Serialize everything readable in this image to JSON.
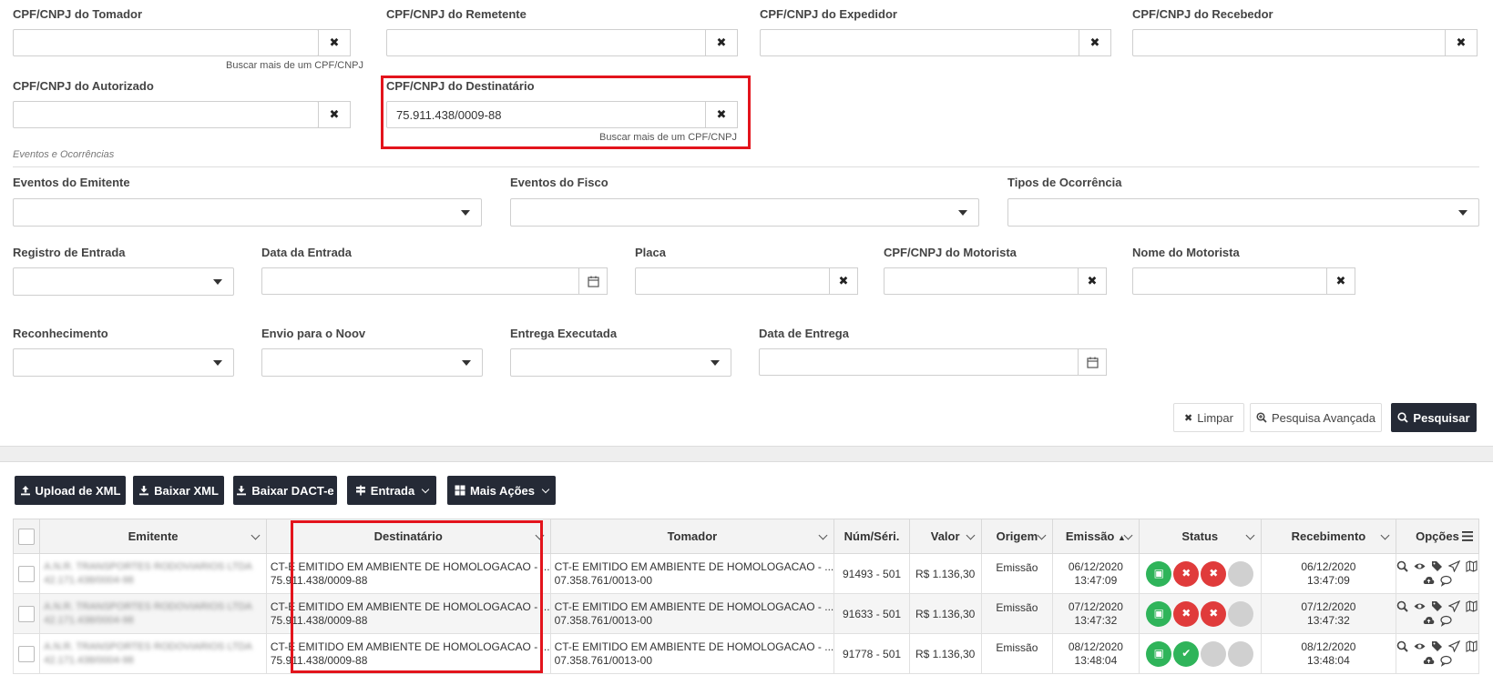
{
  "filters": {
    "tomador": {
      "label": "CPF/CNPJ do Tomador",
      "value": "",
      "hint": "Buscar mais de um CPF/CNPJ"
    },
    "remetente": {
      "label": "CPF/CNPJ do Remetente",
      "value": ""
    },
    "expedidor": {
      "label": "CPF/CNPJ do Expedidor",
      "value": ""
    },
    "recebedor": {
      "label": "CPF/CNPJ do Recebedor",
      "value": ""
    },
    "autorizado": {
      "label": "CPF/CNPJ do Autorizado",
      "value": ""
    },
    "destinatario": {
      "label": "CPF/CNPJ do Destinatário",
      "value": "75.911.438/0009-88",
      "hint": "Buscar mais de um CPF/CNPJ"
    },
    "clear_glyph": "✖",
    "section_title": "Eventos e Ocorrências",
    "eventos_emitente": {
      "label": "Eventos do Emitente"
    },
    "eventos_fisco": {
      "label": "Eventos do Fisco"
    },
    "tipos_ocorrencia": {
      "label": "Tipos de Ocorrência"
    },
    "registro_entrada": {
      "label": "Registro de Entrada"
    },
    "data_entrada": {
      "label": "Data da Entrada",
      "value": ""
    },
    "placa": {
      "label": "Placa",
      "value": ""
    },
    "cpf_motorista": {
      "label": "CPF/CNPJ do Motorista",
      "value": ""
    },
    "nome_motorista": {
      "label": "Nome do Motorista",
      "value": ""
    },
    "reconhecimento": {
      "label": "Reconhecimento"
    },
    "envio_noov": {
      "label": "Envio para o Noov"
    },
    "entrega_executada": {
      "label": "Entrega Executada"
    },
    "data_entrega": {
      "label": "Data de Entrega",
      "value": ""
    }
  },
  "actions": {
    "limpar": "Limpar",
    "pesquisa_avancada": "Pesquisa Avançada",
    "pesquisar": "Pesquisar"
  },
  "toolbar": {
    "upload_xml": "Upload de XML",
    "baixar_xml": "Baixar XML",
    "baixar_dacte": "Baixar DACT-e",
    "entrada": "Entrada",
    "mais_acoes": "Mais Ações"
  },
  "table": {
    "headers": {
      "emitente": "Emitente",
      "destinatario": "Destinatário",
      "tomador": "Tomador",
      "num_serie": "Núm/Séri.",
      "valor": "Valor",
      "origem": "Origem",
      "emissao": "Emissão",
      "status": "Status",
      "recebimento": "Recebimento",
      "opcoes": "Opções"
    },
    "rows": [
      {
        "emitente_name": "A.N.R. TRANSPORTES RODOVIARIOS LTDA",
        "emitente_doc": "42.171.438/0004-98",
        "dest_name": "CT-E EMITIDO EM AMBIENTE DE HOMOLOGACAO - ...",
        "dest_doc": "75.911.438/0009-88",
        "tom_name": "CT-E EMITIDO EM AMBIENTE DE HOMOLOGACAO - ...",
        "tom_doc": "07.358.761/0013-00",
        "num": "91493 - 501",
        "valor": "R$ 1.136,30",
        "origem": "Emissão",
        "emissao_date": "06/12/2020",
        "emissao_time": "13:47:09",
        "rec_date": "06/12/2020",
        "rec_time": "13:47:09"
      },
      {
        "emitente_name": "A.N.R. TRANSPORTES RODOVIARIOS LTDA",
        "emitente_doc": "42.171.438/0004-98",
        "dest_name": "CT-E EMITIDO EM AMBIENTE DE HOMOLOGACAO - ...",
        "dest_doc": "75.911.438/0009-88",
        "tom_name": "CT-E EMITIDO EM AMBIENTE DE HOMOLOGACAO - ...",
        "tom_doc": "07.358.761/0013-00",
        "num": "91633 - 501",
        "valor": "R$ 1.136,30",
        "origem": "Emissão",
        "emissao_date": "07/12/2020",
        "emissao_time": "13:47:32",
        "rec_date": "07/12/2020",
        "rec_time": "13:47:32"
      },
      {
        "emitente_name": "A.N.R. TRANSPORTES RODOVIARIOS LTDA",
        "emitente_doc": "42.171.438/0004-98",
        "dest_name": "CT-E EMITIDO EM AMBIENTE DE HOMOLOGACAO - ...",
        "dest_doc": "75.911.438/0009-88",
        "tom_name": "CT-E EMITIDO EM AMBIENTE DE HOMOLOGACAO - ...",
        "tom_doc": "07.358.761/0013-00",
        "num": "91778 - 501",
        "valor": "R$ 1.136,30",
        "origem": "Emissão",
        "emissao_date": "08/12/2020",
        "emissao_time": "13:48:04",
        "rec_date": "08/12/2020",
        "rec_time": "13:48:04"
      }
    ]
  },
  "colors": {
    "highlight": "#e3141c",
    "dark_button": "#252a36",
    "status_green": "#2fb45a",
    "status_red": "#e03b3b",
    "status_gray": "#d0d0d0"
  }
}
